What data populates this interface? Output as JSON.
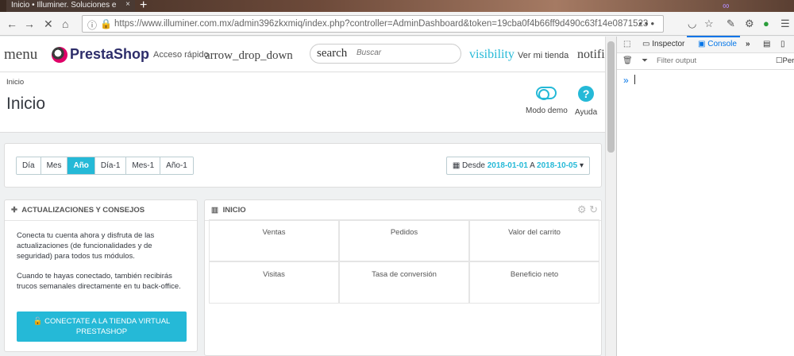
{
  "browser": {
    "tab_title": "Inicio • Illuminer. Soluciones e",
    "url": "https://www.illuminer.com.mx/admin396zkxmiq/index.php?controller=AdminDashboard&token=19cba0f4b66ff9d490c63f14e0871523",
    "dots": "•••"
  },
  "header": {
    "menu_text": "menu",
    "brand": "PrestaShop",
    "quick_access": "Acceso rápido",
    "quick_access_icon": "arrow_drop_down",
    "search_label": "search",
    "search_placeholder": "Buscar",
    "visibility_icon": "visibility",
    "view_store": "Ver mi tienda",
    "notifications_icon": "notifi"
  },
  "page": {
    "breadcrumb": "Inicio",
    "title": "Inicio",
    "demo_mode": "Modo demo",
    "help": "Ayuda"
  },
  "period": {
    "buttons": [
      "Día",
      "Mes",
      "Año",
      "Día-1",
      "Mes-1",
      "Año-1"
    ],
    "active": "Año",
    "from_label": "Desde",
    "from_date": "2018-01-01",
    "to_label": "A",
    "to_date": "2018-10-05"
  },
  "updates_panel": {
    "title": "Actualizaciones y consejos",
    "paragraph1": "Conecta tu cuenta ahora y disfruta de las actualizaciones (de funcionalidades y de seguridad) para todos tus módulos.",
    "paragraph2": "Cuando te hayas conectado, también recibirás trucos semanales directamente en tu back-office.",
    "cta_line1": "CONECTATE A LA TIENDA VIRTUAL",
    "cta_line2": "PRESTASHOP"
  },
  "inicio_panel": {
    "title": "Inicio",
    "kpis": [
      "Ventas",
      "Pedidos",
      "Valor del carrito",
      "Visitas",
      "Tasa de conversión",
      "Beneficio neto"
    ]
  },
  "devtools": {
    "tab_inspector": "Inspector",
    "tab_console": "Console",
    "filter_placeholder": "Filter output",
    "persist_label": "Per",
    "prompt": "»"
  },
  "colors": {
    "accent": "#25b9d7",
    "brand": "#df0067"
  }
}
